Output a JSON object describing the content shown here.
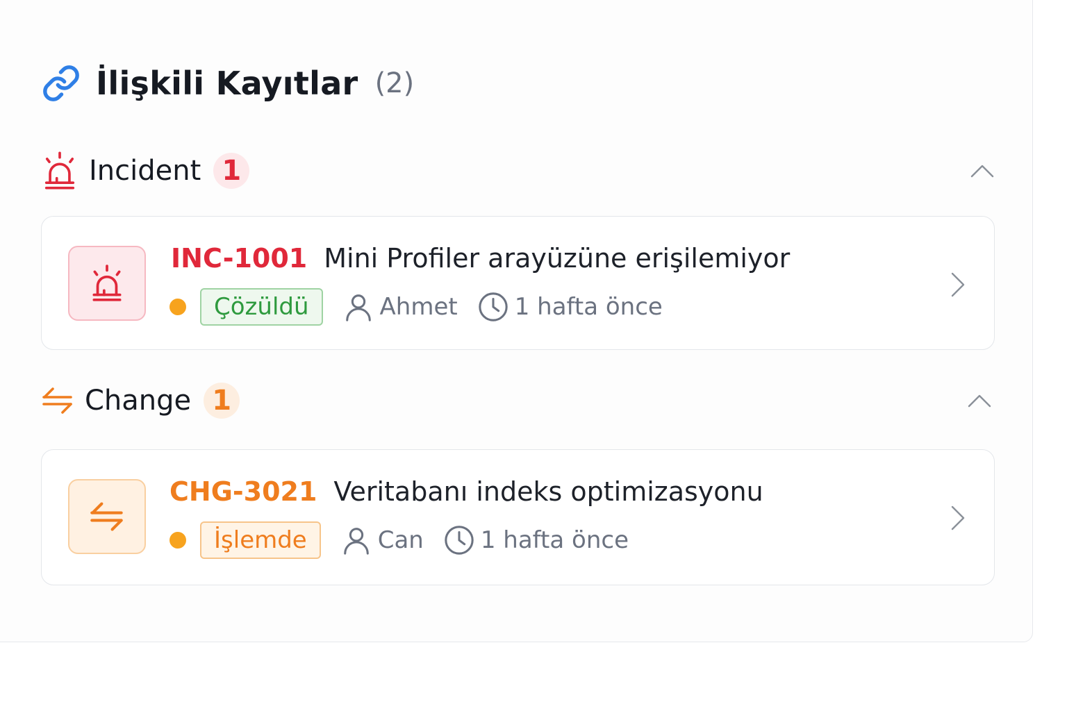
{
  "header": {
    "title": "İlişkili Kayıtlar",
    "count": "(2)",
    "icon": "link-icon",
    "icon_color": "#2f7fe6"
  },
  "sections": [
    {
      "label": "Incident",
      "count": "1",
      "icon": "siren-icon",
      "accent": "#e0283a",
      "items": [
        {
          "code": "INC-1001",
          "subject": "Mini Profiler arayüzüne erişilemiyor",
          "status": "Çözüldü",
          "user": "Ahmet",
          "time": "1 hafta önce"
        }
      ]
    },
    {
      "label": "Change",
      "count": "1",
      "icon": "swap-arrows-icon",
      "accent": "#ef7d1e",
      "items": [
        {
          "code": "CHG-3021",
          "subject": "Veritabanı indeks optimizasyonu",
          "status": "İşlemde",
          "user": "Can",
          "time": "1 hafta önce"
        }
      ]
    }
  ],
  "colors": {
    "status_resolved_text": "#2e9a3e",
    "status_resolved_bg": "#eef8ee",
    "status_resolved_border": "#9fd3a3",
    "status_progress_text": "#ef7d1e",
    "status_progress_bg": "#fff4e6",
    "status_progress_border": "#f7c48a",
    "priority_dot": "#f7a31e"
  }
}
